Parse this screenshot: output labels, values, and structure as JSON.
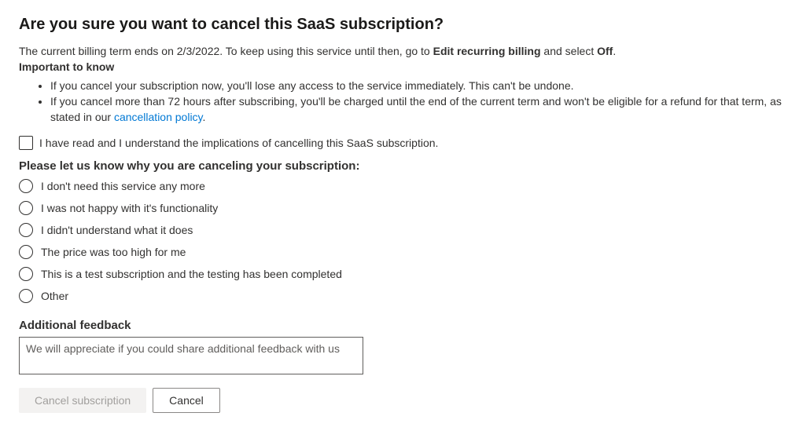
{
  "heading": "Are you sure you want to cancel this SaaS subscription?",
  "intro": {
    "prefix": "The current billing term ends on 2/3/2022. To keep using this service until then, go to ",
    "bold1": "Edit recurring billing",
    "mid": " and select ",
    "bold2": "Off",
    "suffix": "."
  },
  "important_label": "Important to know",
  "bullets": {
    "b1": "If you cancel your subscription now, you'll lose any access to the service immediately. This can't be undone.",
    "b2_prefix": "If you cancel more than 72 hours after subscribing, you'll be charged until the end of the current term and won't be eligible for a refund for that term, as stated in our ",
    "b2_link": "cancellation policy",
    "b2_suffix": "."
  },
  "ack_label": "I have read and I understand the implications of cancelling this SaaS subscription.",
  "reason_label": "Please let us know why you are canceling your subscription:",
  "reasons": {
    "r0": "I don't need this service any more",
    "r1": "I was not happy with it's functionality",
    "r2": "I didn't understand what it does",
    "r3": "The price was too high for me",
    "r4": "This is a test subscription and the testing has been completed",
    "r5": "Other"
  },
  "feedback_label": "Additional feedback",
  "feedback_placeholder": "We will appreciate if you could share additional feedback with us",
  "buttons": {
    "confirm": "Cancel subscription",
    "cancel": "Cancel"
  }
}
